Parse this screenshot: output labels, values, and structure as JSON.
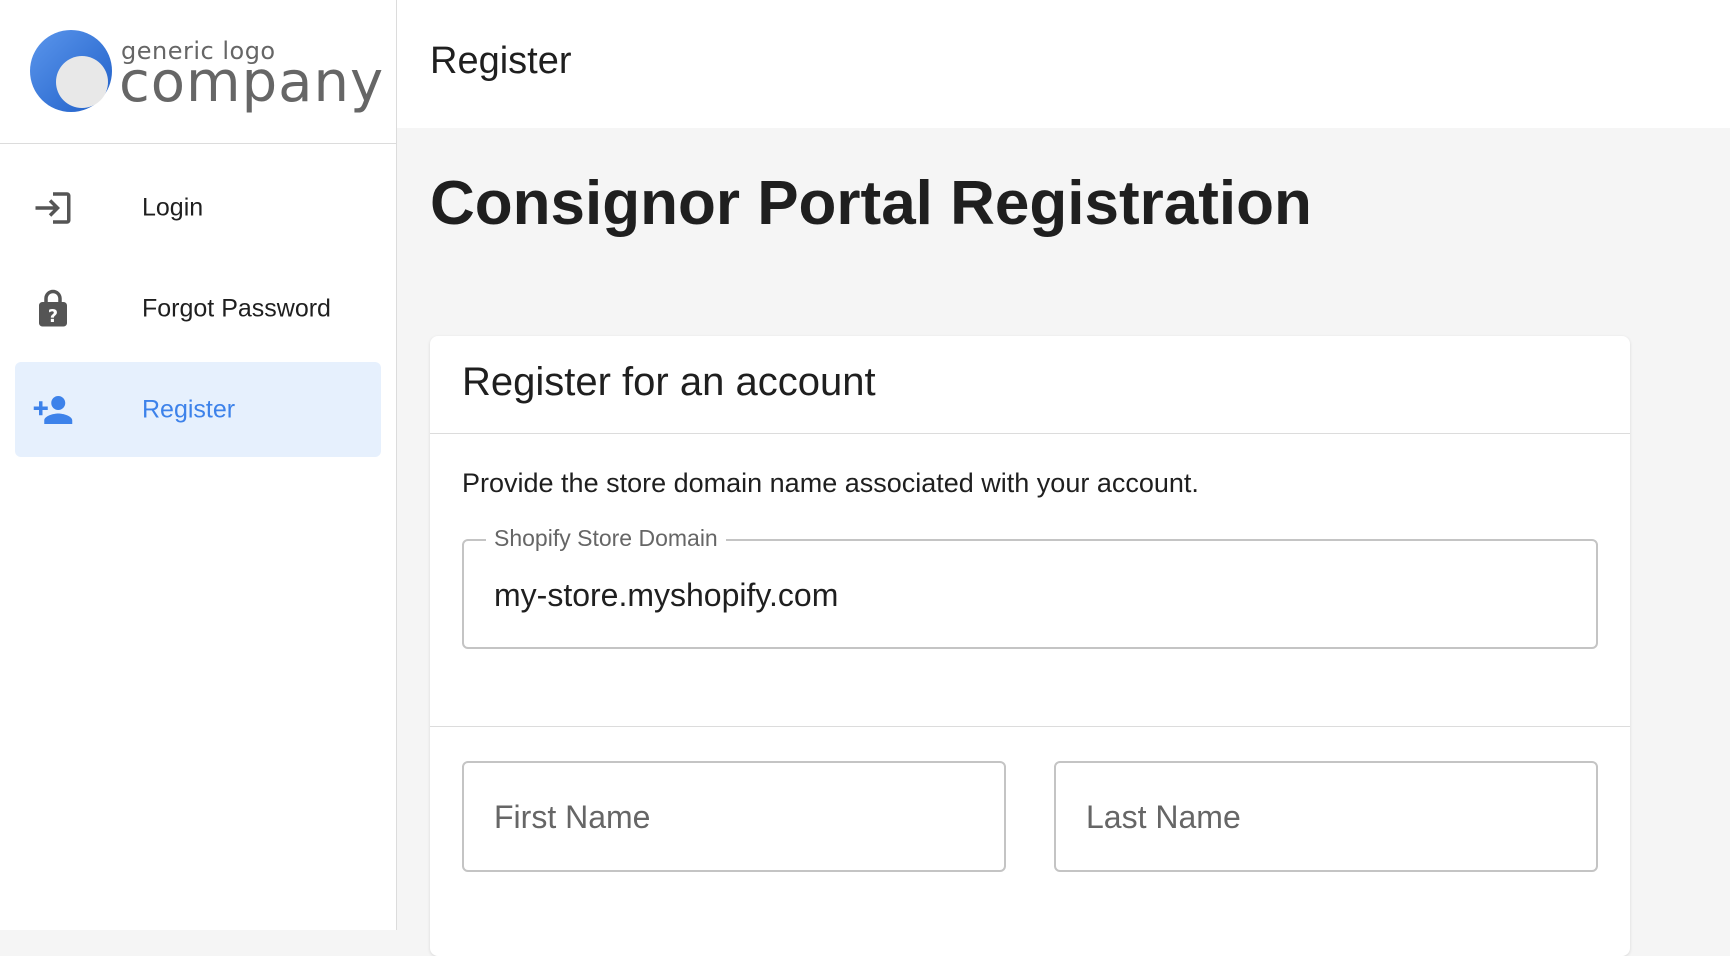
{
  "logo": {
    "small_text": "generic logo",
    "big_text": "company"
  },
  "sidebar": {
    "items": [
      {
        "label": "Login",
        "icon": "login-icon"
      },
      {
        "label": "Forgot Password",
        "icon": "lock-question-icon"
      },
      {
        "label": "Register",
        "icon": "person-add-icon",
        "active": true
      }
    ]
  },
  "header": {
    "title": "Register"
  },
  "main": {
    "title": "Consignor Portal Registration",
    "card": {
      "title": "Register for an account",
      "description": "Provide the store domain name associated with your account.",
      "domain_field": {
        "label": "Shopify Store Domain",
        "value": "my-store.myshopify.com"
      },
      "first_name_placeholder": "First Name",
      "last_name_placeholder": "Last Name"
    }
  },
  "colors": {
    "accent": "#3d82ea",
    "active_bg": "#e6f0fd",
    "page_bg": "#f5f5f5"
  }
}
